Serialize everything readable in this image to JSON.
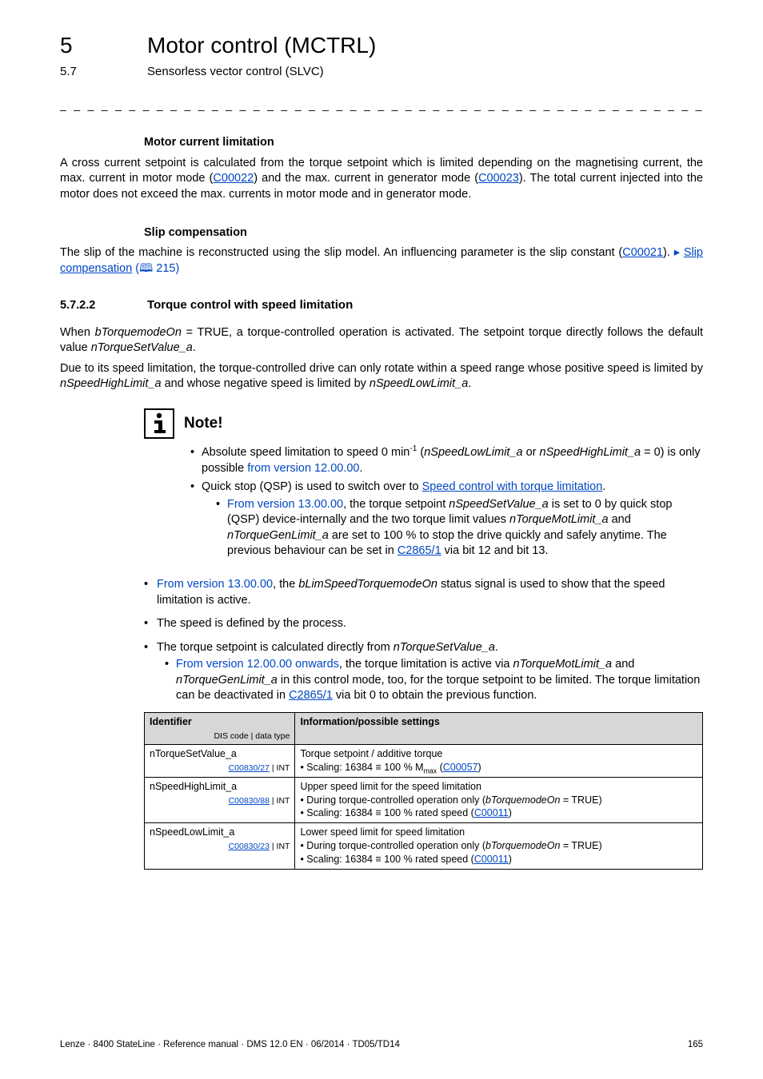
{
  "header": {
    "chapter_num": "5",
    "chapter_title": "Motor control (MCTRL)",
    "section_num": "5.7",
    "section_title": "Sensorless vector control (SLVC)",
    "dash_rule": "_ _ _ _ _ _ _ _ _ _ _ _ _ _ _ _ _ _ _ _ _ _ _ _ _ _ _ _ _ _ _ _ _ _ _ _ _ _ _ _ _ _ _ _ _ _ _ _ _ _ _ _ _ _ _ _ _ _ _ _ _ _ _ _"
  },
  "mcl": {
    "heading": "Motor current limitation",
    "p1a": "A cross current setpoint is calculated from the torque setpoint which is limited depending on the magnetising current, the max. current in motor mode (",
    "p1link1": "C00022",
    "p1b": ") and the max. current in generator mode (",
    "p1link2": "C00023",
    "p1c": "). The total current injected into the motor does not exceed the max. currents in motor mode and in  generator mode."
  },
  "slip": {
    "heading": "Slip compensation",
    "p1a": "The slip of the machine is reconstructed using the slip model. An influencing parameter is the slip constant (",
    "p1link1": "C00021",
    "p1b": ").  ",
    "arrow": "▸",
    "p1link2": "Slip compensation",
    "pageref": " (🕮 215)"
  },
  "sec5722": {
    "num": "5.7.2.2",
    "title": "Torque control with speed limitation",
    "p1a": "When ",
    "p1it": "bTorquemodeOn",
    "p1b": " = TRUE, a torque-controlled operation is activated. The setpoint torque directly follows the default value ",
    "p1it2": "nTorqueSetValue_a",
    "p1c": ".",
    "p2a": "Due to its speed limitation, the torque-controlled drive can only rotate within a speed range whose positive speed is limited by ",
    "p2it1": "nSpeedHighLimit_a",
    "p2b": " and whose negative speed is limited by ",
    "p2it2": "nSpeedLowLimit_a",
    "p2c": "."
  },
  "note": {
    "label": "Note!",
    "b1a": "Absolute speed limitation to speed 0 min",
    "b1sup": "-1",
    "b1b": " (",
    "b1it1": "nSpeedLowLimit_a",
    "b1c": " or ",
    "b1it2": "nSpeedHighLimit_a",
    "b1d": " = 0) is only possible ",
    "b1blue": "from version 12.00.00",
    "b1e": ".",
    "b2a": "Quick stop (QSP) is used to switch over to ",
    "b2link": "Speed control with torque limitation",
    "b2b": ".",
    "b2i_a": "From version 13.00.00",
    "b2i_b": ", the torque setpoint ",
    "b2i_it1": "nSpeedSetValue_a",
    "b2i_c": " is set to 0 by quick stop (QSP) device-internally and the two torque limit values ",
    "b2i_it2": "nTorqueMotLimit_a",
    "b2i_d": " and ",
    "b2i_it3": "nTorqueGenLimit_a",
    "b2i_e": " are set to 100 % to stop the drive quickly and safely anytime. The previous behaviour can be set in ",
    "b2i_link": "C2865/1",
    "b2i_f": " via bit 12 and bit 13."
  },
  "outer": {
    "o1a": "From version 13.00.00",
    "o1b": ", the ",
    "o1it": "bLimSpeedTorquemodeOn",
    "o1c": " status signal is used to show that the speed limitation is active.",
    "o2": "The speed is defined by the process.",
    "o3a": "The torque setpoint is calculated directly from ",
    "o3it": "nTorqueSetValue_a",
    "o3b": ".",
    "o3i_a": "From version 12.00.00 onwards",
    "o3i_b": ", the torque limitation is active via ",
    "o3i_it1": "nTorqueMotLimit_a",
    "o3i_c": " and ",
    "o3i_it2": "nTorqueGenLimit_a",
    "o3i_d": " in this control mode, too, for the torque setpoint to be limited. The torque limitation can be deactivated in ",
    "o3i_link": "C2865/1",
    "o3i_e": " via bit 0 to obtain the previous function."
  },
  "table": {
    "h1": "Identifier",
    "h1sub": "DIS code | data type",
    "h2": "Information/possible settings",
    "r1_id": "nTorqueSetValue_a",
    "r1_code": "C00830/27",
    "r1_type": " | INT",
    "r1_l1": "Torque setpoint / additive torque",
    "r1_l2a": "• Scaling: 16384 ≡ 100 % M",
    "r1_l2sub": "max",
    "r1_l2b": " (",
    "r1_l2link": "C00057",
    "r1_l2c": ")",
    "r2_id": "nSpeedHighLimit_a",
    "r2_code": "C00830/88",
    "r2_type": " | INT",
    "r2_l1": "Upper speed limit for the speed limitation",
    "r2_l2a": "• During torque-controlled operation only (",
    "r2_l2it": "bTorquemodeOn",
    "r2_l2b": " = TRUE)",
    "r2_l3a": "• Scaling: 16384 ≡ 100 % rated speed (",
    "r2_l3link": "C00011",
    "r2_l3b": ")",
    "r3_id": "nSpeedLowLimit_a",
    "r3_code": "C00830/23",
    "r3_type": " | INT",
    "r3_l1": "Lower speed limit for speed limitation",
    "r3_l2a": "• During torque-controlled operation only (",
    "r3_l2it": "bTorquemodeOn",
    "r3_l2b": " = TRUE)",
    "r3_l3a": "• Scaling: 16384 ≡ 100 % rated speed (",
    "r3_l3link": "C00011",
    "r3_l3b": ")"
  },
  "footer": {
    "left": "Lenze · 8400 StateLine · Reference manual · DMS 12.0 EN · 06/2014 · TD05/TD14",
    "right": "165"
  }
}
